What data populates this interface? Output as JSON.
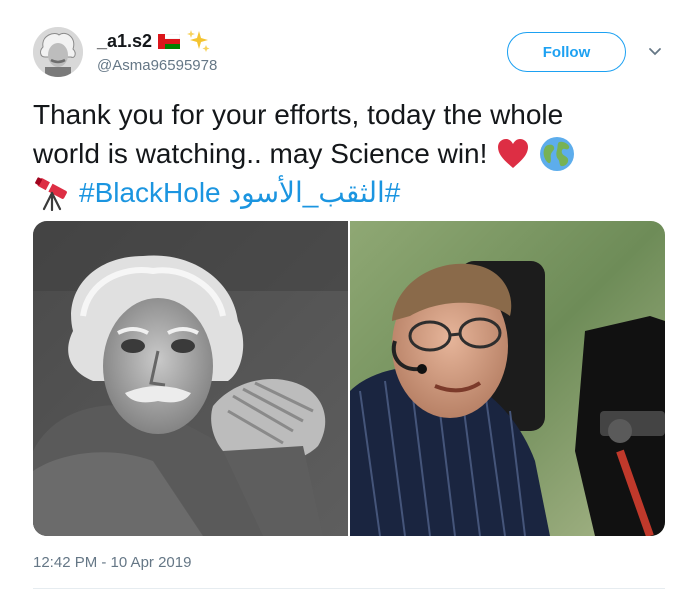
{
  "user": {
    "display_name": "_a1.s2",
    "handle": "@Asma96595978"
  },
  "header": {
    "follow_label": "Follow"
  },
  "tweet": {
    "line1": "Thank you for your efforts, today the whole",
    "line2": "world is watching.. may Science win!",
    "hashtag_en": "#BlackHole",
    "hashtag_ar": "#الثقب_الأسود",
    "timestamp": "12:42 PM - 10 Apr 2019"
  },
  "icons": {
    "flag": "oman-flag-icon",
    "sparkles": "sparkles-icon",
    "heart": "red-heart-icon",
    "globe": "globe-icon",
    "telescope": "telescope-icon",
    "chevron": "chevron-down-icon"
  },
  "colors": {
    "link": "#1b95e0",
    "follow_border": "#1da1f2",
    "muted": "#657786",
    "text": "#14171a"
  }
}
